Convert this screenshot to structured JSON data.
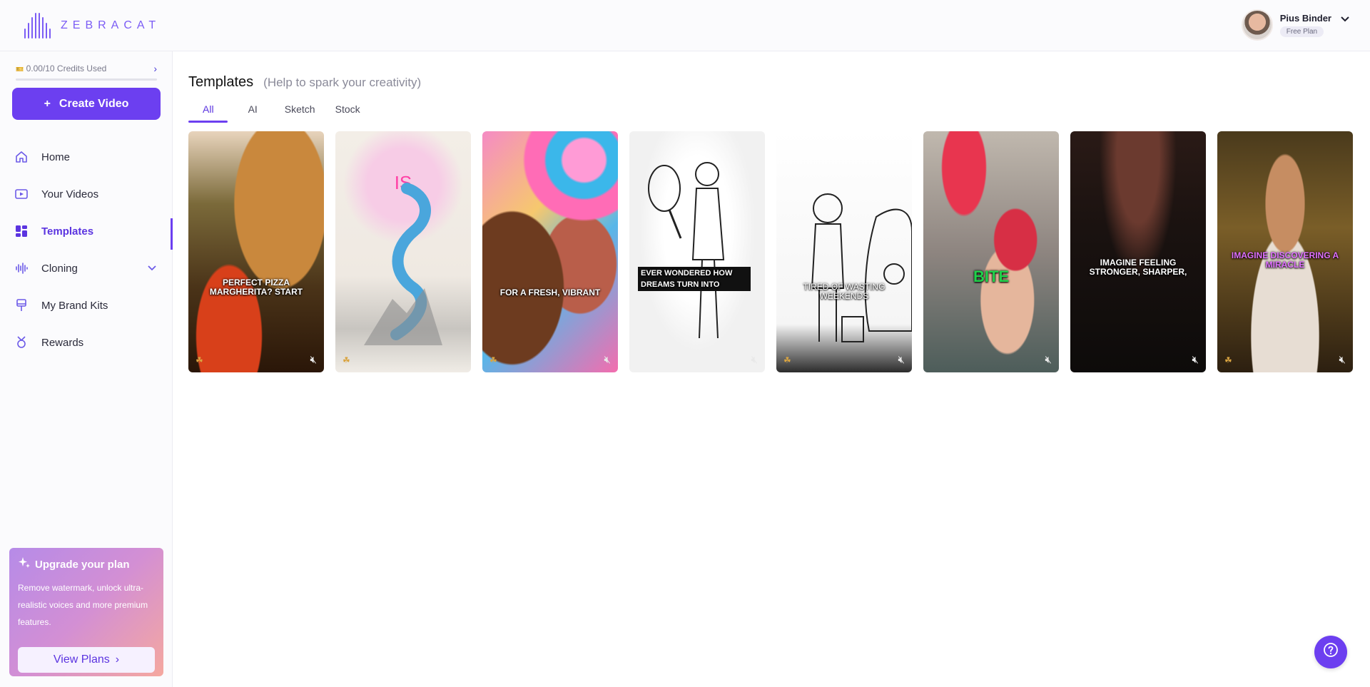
{
  "brand": {
    "name": "ZEBRACAT"
  },
  "user": {
    "name": "Pius Binder",
    "plan": "Free Plan"
  },
  "sidebar": {
    "credits": "0.00/10 Credits Used",
    "credits_progress": 0,
    "create_label": "Create Video",
    "items": [
      {
        "label": "Home",
        "icon": "home-icon"
      },
      {
        "label": "Your Videos",
        "icon": "video-icon"
      },
      {
        "label": "Templates",
        "icon": "templates-icon",
        "active": true
      },
      {
        "label": "Cloning",
        "icon": "waveform-icon",
        "expandable": true
      },
      {
        "label": "My Brand Kits",
        "icon": "brush-icon"
      },
      {
        "label": "Rewards",
        "icon": "trophy-icon"
      }
    ],
    "upgrade": {
      "title": "Upgrade your plan",
      "text": "Remove watermark, unlock ultra-realistic voices and more premium features.",
      "button": "View Plans"
    }
  },
  "main": {
    "title": "Templates",
    "subtitle": "(Help to spark your creativity)",
    "tabs": [
      {
        "label": "All",
        "active": true
      },
      {
        "label": "AI"
      },
      {
        "label": "Sketch"
      },
      {
        "label": "Stock"
      }
    ],
    "templates": [
      {
        "caption": "PERFECT PIZZA MARGHERITA? START"
      },
      {
        "caption": "IS"
      },
      {
        "caption": "FOR A FRESH, VIBRANT"
      },
      {
        "caption": "EVER WONDERED HOW DREAMS TURN INTO"
      },
      {
        "caption": "TIRED OF WASTING WEEKENDS"
      },
      {
        "caption": "BITE"
      },
      {
        "caption": "IMAGINE FEELING STRONGER, SHARPER,"
      },
      {
        "caption": "IMAGINE DISCOVERING A MIRACLE"
      }
    ]
  },
  "help": {
    "icon": "help-icon"
  },
  "colors": {
    "accent": "#6c3ff0",
    "active_text": "#5b34e0"
  }
}
